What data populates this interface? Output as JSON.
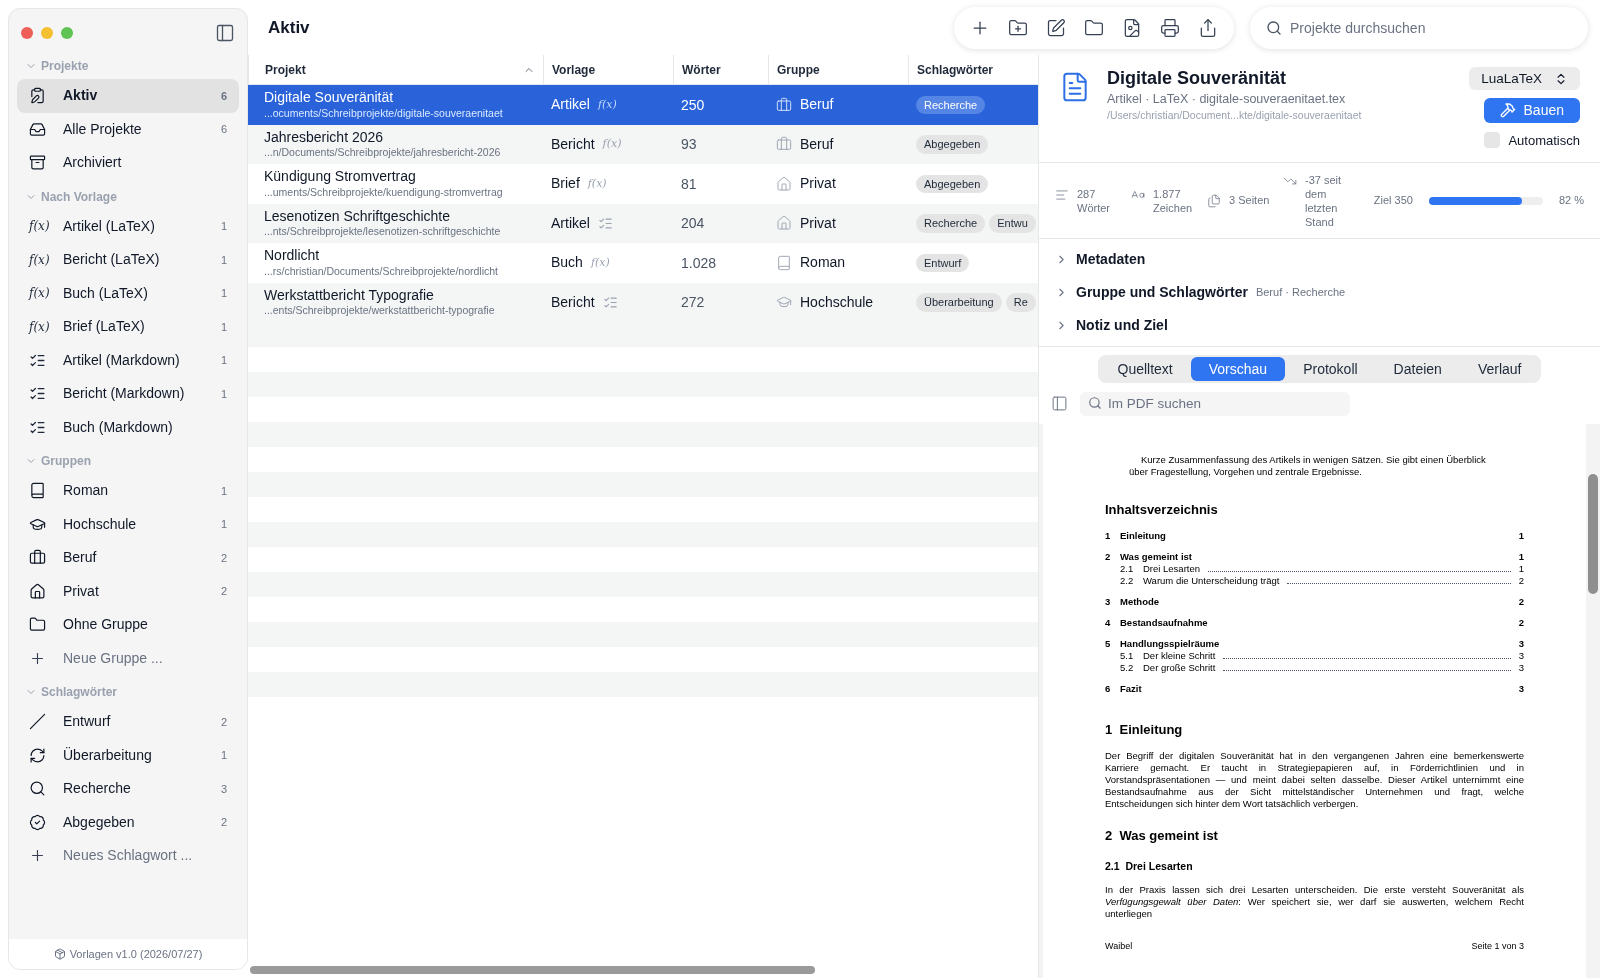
{
  "window": {
    "title": "Aktiv"
  },
  "sidebar": {
    "sections": [
      {
        "title": "Projekte",
        "expanded": true,
        "items": [
          {
            "label": "Aktiv",
            "count": "6",
            "selected": true
          },
          {
            "label": "Alle Projekte",
            "count": "6",
            "selected": false
          },
          {
            "label": "Archiviert",
            "selected": false
          }
        ]
      },
      {
        "title": "Nach Vorlage",
        "expanded": true,
        "items": [
          {
            "label": "Artikel (LaTeX)",
            "count": "1",
            "kind": "latex",
            "symbol": "f(x)",
            "selected": false
          },
          {
            "label": "Bericht (LaTeX)",
            "count": "1",
            "kind": "latex",
            "symbol": "f(x)",
            "selected": false
          },
          {
            "label": "Buch (LaTeX)",
            "count": "1",
            "kind": "latex",
            "symbol": "f(x)",
            "selected": false
          },
          {
            "label": "Brief (LaTeX)",
            "count": "1",
            "kind": "latex",
            "symbol": "f(x)",
            "selected": false
          },
          {
            "label": "Artikel (Markdown)",
            "count": "1",
            "kind": "markdown",
            "selected": false
          },
          {
            "label": "Bericht (Markdown)",
            "count": "1",
            "kind": "markdown",
            "selected": false
          },
          {
            "label": "Buch (Markdown)",
            "kind": "markdown",
            "selected": false
          }
        ]
      },
      {
        "title": "Gruppen",
        "expanded": true,
        "items": [
          {
            "label": "Roman",
            "count": "1",
            "selected": false
          },
          {
            "label": "Hochschule",
            "count": "1",
            "selected": false
          },
          {
            "label": "Beruf",
            "count": "2",
            "selected": false
          },
          {
            "label": "Privat",
            "count": "2",
            "selected": false
          },
          {
            "label": "Ohne Gruppe",
            "selected": false
          }
        ],
        "add_label": "Neue Gruppe ..."
      },
      {
        "title": "Schlagwörter",
        "expanded": true,
        "items": [
          {
            "label": "Entwurf",
            "count": "2",
            "selected": false
          },
          {
            "label": "Überarbeitung",
            "count": "1",
            "selected": false
          },
          {
            "label": "Recherche",
            "count": "3",
            "selected": false
          },
          {
            "label": "Abgegeben",
            "count": "2",
            "selected": false
          }
        ],
        "add_label": "Neues Schlagwort ..."
      }
    ],
    "footer": "Vorlagen v1.0 (2026/07/27)"
  },
  "toolbar": {
    "search_placeholder": "Projekte durchsuchen"
  },
  "table": {
    "columns": [
      {
        "label": "Projekt",
        "sorted": true
      },
      {
        "label": "Vorlage",
        "sorted": false
      },
      {
        "label": "Wörter",
        "sorted": false
      },
      {
        "label": "Gruppe",
        "sorted": false
      },
      {
        "label": "Schlagwörter",
        "sorted": false
      }
    ],
    "rows": [
      {
        "title": "Digitale Souveränität",
        "path": "...ocuments/Schreibprojekte/digitale-souveraenitaet",
        "template": "Artikel",
        "kind": "latex",
        "symbol": "f(x)",
        "words": "250",
        "group": "Beruf",
        "tags": [
          "Recherche"
        ],
        "selected": true
      },
      {
        "title": "Jahresbericht 2026",
        "path": "...n/Documents/Schreibprojekte/jahresbericht-2026",
        "template": "Bericht",
        "kind": "latex",
        "symbol": "f(x)",
        "words": "93",
        "group": "Beruf",
        "tags": [
          "Abgegeben"
        ],
        "selected": false
      },
      {
        "title": "Kündigung Stromvertrag",
        "path": "...uments/Schreibprojekte/kuendigung-stromvertrag",
        "template": "Brief",
        "kind": "latex",
        "symbol": "f(x)",
        "words": "81",
        "group": "Privat",
        "tags": [
          "Abgegeben"
        ],
        "selected": false
      },
      {
        "title": "Lesenotizen Schriftgeschichte",
        "path": "...nts/Schreibprojekte/lesenotizen-schriftgeschichte",
        "template": "Artikel",
        "kind": "markdown",
        "words": "204",
        "group": "Privat",
        "tags": [
          "Recherche",
          "Entwu"
        ],
        "selected": false
      },
      {
        "title": "Nordlicht",
        "path": "...rs/christian/Documents/Schreibprojekte/nordlicht",
        "template": "Buch",
        "kind": "latex",
        "symbol": "f(x)",
        "words": "1.028",
        "group": "Roman",
        "tags": [
          "Entwurf"
        ],
        "selected": false
      },
      {
        "title": "Werkstattbericht Typografie",
        "path": "...ents/Schreibprojekte/werkstattbericht-typografie",
        "template": "Bericht",
        "kind": "markdown",
        "words": "272",
        "group": "Hochschule",
        "tags": [
          "Überarbeitung",
          "Re"
        ],
        "selected": false
      }
    ]
  },
  "detail": {
    "title": "Digitale Souveränität",
    "subtitle": "Artikel · LaTeX · digitale-souveraenitaet.tex",
    "path": "/Users/christian/Document...kte/digitale-souveraenitaet",
    "engine": "LuaLaTeX",
    "build_label": "Bauen",
    "auto": {
      "label": "Automatisch",
      "checked": false
    },
    "stats": [
      "287 Wörter",
      "1.877 Zeichen",
      "3 Seiten",
      "-37 seit dem letzten Stand"
    ],
    "goal": {
      "label": "Ziel 350",
      "level": 0.82,
      "reading": "82 %"
    },
    "sections": [
      {
        "label": "Metadaten",
        "expanded": false
      },
      {
        "label": "Gruppe und Schlagwörter",
        "summary": "Beruf · Recherche",
        "expanded": false
      },
      {
        "label": "Notiz und Ziel",
        "expanded": false
      }
    ],
    "tabs": [
      {
        "label": "Quelltext",
        "selected": false
      },
      {
        "label": "Vorschau",
        "selected": true
      },
      {
        "label": "Protokoll",
        "selected": false
      },
      {
        "label": "Dateien",
        "selected": false
      },
      {
        "label": "Verlauf",
        "selected": false
      }
    ],
    "pdf_search_placeholder": "Im PDF suchen",
    "pdf": {
      "abstract": "Kurze Zusammenfassung des Artikels in wenigen Sätzen. Sie gibt einen Überblick über Fragestellung, Vorgehen und zentrale Ergebnisse.",
      "toc_title": "Inhaltsverzeichnis",
      "toc": [
        {
          "number": "1",
          "title": "Einleitung",
          "page": "1"
        },
        {
          "number": "2",
          "title": "Was gemeint ist",
          "page": "1",
          "children": [
            {
              "number": "2.1",
              "title": "Drei Lesarten",
              "page": "1"
            },
            {
              "number": "2.2",
              "title": "Warum die Unterscheidung trägt",
              "page": "2"
            }
          ]
        },
        {
          "number": "3",
          "title": "Methode",
          "page": "2"
        },
        {
          "number": "4",
          "title": "Bestandsaufnahme",
          "page": "2"
        },
        {
          "number": "5",
          "title": "Handlungsspielräume",
          "page": "3",
          "children": [
            {
              "number": "5.1",
              "title": "Der kleine Schritt",
              "page": "3"
            },
            {
              "number": "5.2",
              "title": "Der große Schritt",
              "page": "3"
            }
          ]
        },
        {
          "number": "6",
          "title": "Fazit",
          "page": "3"
        }
      ],
      "body": [
        {
          "kind": "section",
          "number": "1",
          "title": "Einleitung"
        },
        {
          "kind": "paragraph",
          "text": "Der Begriff der digitalen Souveränität hat in den vergangenen Jahren eine bemerkenswerte Karriere gemacht. Er taucht in Strategiepapieren auf, in Förderrichtlinien und in Vorstandspräsentationen — und meint dabei selten dasselbe. Dieser Artikel unternimmt eine Bestandsaufnahme aus der Sicht mittelständischer Unternehmen und fragt, welche Entscheidungen sich hinter dem Wort tatsächlich verbergen."
        },
        {
          "kind": "section",
          "number": "2",
          "title": "Was gemeint ist"
        },
        {
          "kind": "subsection",
          "number": "2.1",
          "title": "Drei Lesarten"
        },
        {
          "kind": "paragraph",
          "text": "In der Praxis lassen sich drei Lesarten unterscheiden. Die erste versteht Souveränität als *Verfügungsgewalt über Daten*: Wer speichert sie, wer darf sie auswerten, welchem Recht unterliegen"
        }
      ],
      "footer_left": "Waibel",
      "footer_right": "Seite 1 von 3"
    }
  }
}
